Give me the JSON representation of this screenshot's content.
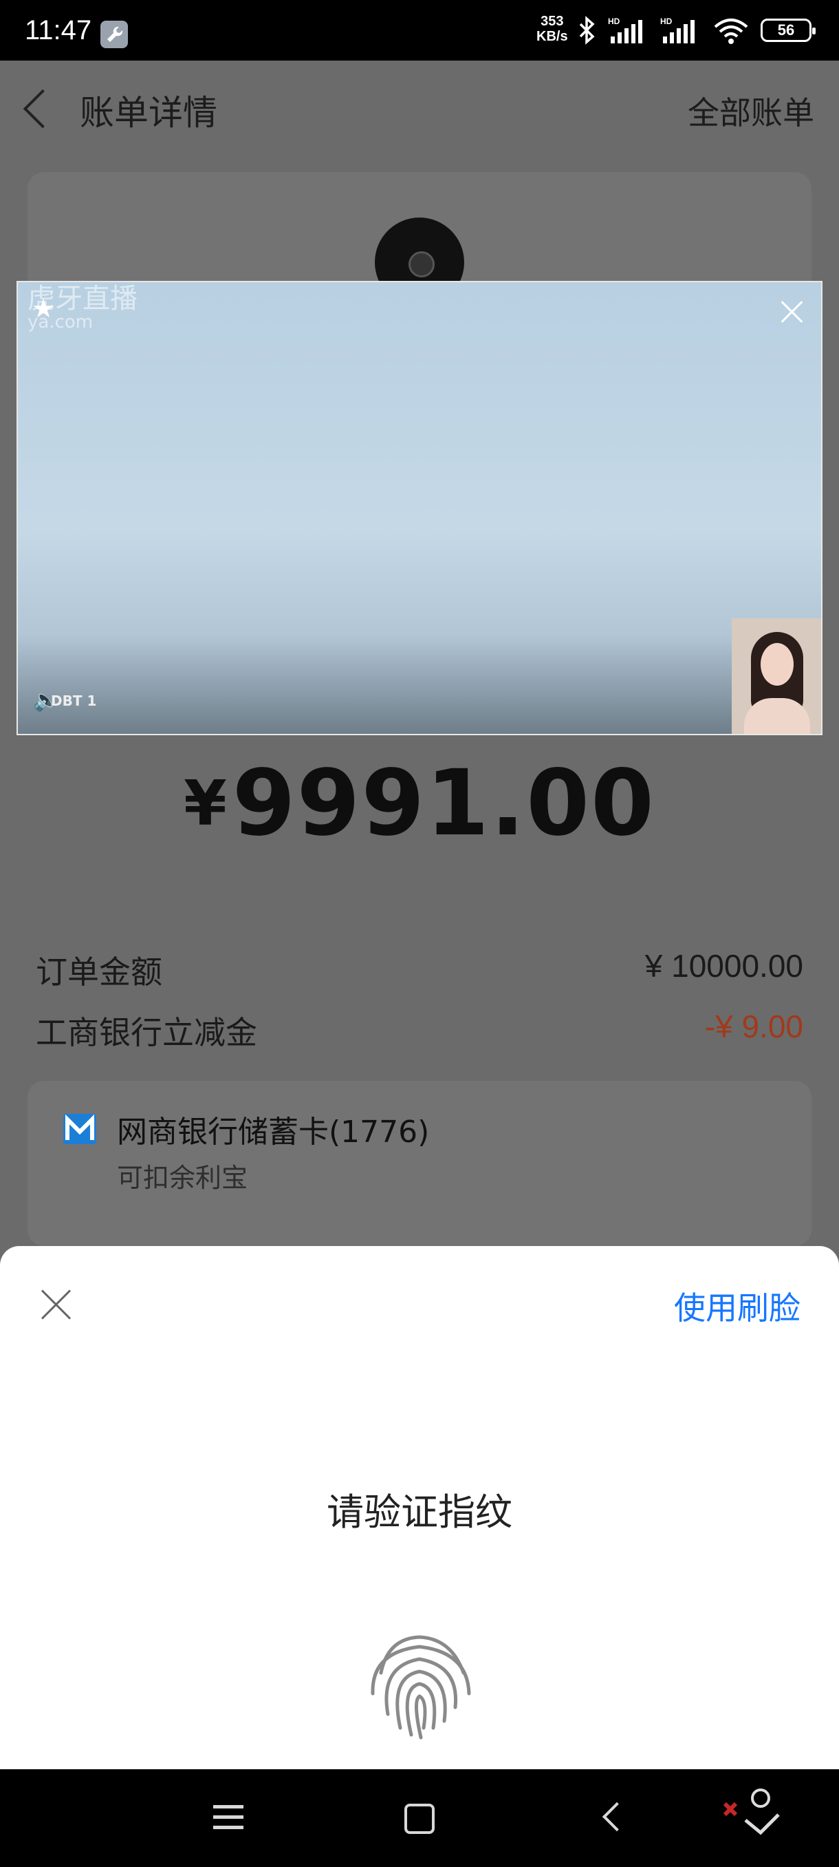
{
  "status_bar": {
    "time": "11:47",
    "net_speed_value": "353",
    "net_speed_unit": "KB/s",
    "battery": "56"
  },
  "header": {
    "title": "账单详情",
    "right_link": "全部账单"
  },
  "video_popup": {
    "watermark": "虎牙直播",
    "watermark_url": "ya.com",
    "tag": "DBT 1"
  },
  "bill": {
    "currency_symbol": "¥",
    "amount": "9991.00",
    "rows": [
      {
        "label": "订单金额",
        "value": "¥ 10000.00"
      },
      {
        "label": "工商银行立减金",
        "value": "-¥ 9.00"
      }
    ],
    "payment_method": {
      "name": "网商银行储蓄卡(1776)",
      "sub": "可扣余利宝"
    }
  },
  "sheet": {
    "face_link": "使用刷脸",
    "prompt": "请验证指纹"
  },
  "colors": {
    "link_blue": "#1677ff",
    "discount_red": "#a13a1b",
    "bank_blue": "#1b7fd6"
  }
}
